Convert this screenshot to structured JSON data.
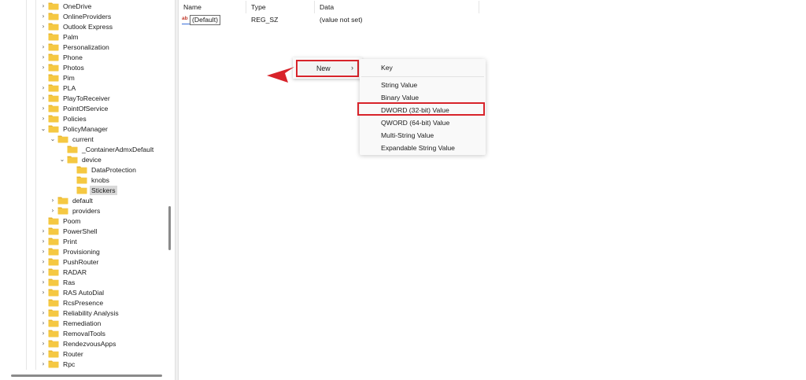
{
  "tree": {
    "items": [
      {
        "label": "OneDrive",
        "expander": "collapsed",
        "level": 0
      },
      {
        "label": "OnlineProviders",
        "expander": "collapsed",
        "level": 0
      },
      {
        "label": "Outlook Express",
        "expander": "collapsed",
        "level": 0
      },
      {
        "label": "Palm",
        "expander": "none",
        "level": 0
      },
      {
        "label": "Personalization",
        "expander": "collapsed",
        "level": 0
      },
      {
        "label": "Phone",
        "expander": "collapsed",
        "level": 0
      },
      {
        "label": "Photos",
        "expander": "collapsed",
        "level": 0
      },
      {
        "label": "Pim",
        "expander": "none",
        "level": 0
      },
      {
        "label": "PLA",
        "expander": "collapsed",
        "level": 0
      },
      {
        "label": "PlayToReceiver",
        "expander": "collapsed",
        "level": 0
      },
      {
        "label": "PointOfService",
        "expander": "collapsed",
        "level": 0
      },
      {
        "label": "Policies",
        "expander": "collapsed",
        "level": 0
      },
      {
        "label": "PolicyManager",
        "expander": "expanded",
        "level": 0
      },
      {
        "label": "current",
        "expander": "expanded",
        "level": 1
      },
      {
        "label": "_ContainerAdmxDefault",
        "expander": "none",
        "level": 2
      },
      {
        "label": "device",
        "expander": "expanded",
        "level": 2
      },
      {
        "label": "DataProtection",
        "expander": "none",
        "level": 3
      },
      {
        "label": "knobs",
        "expander": "none",
        "level": 3
      },
      {
        "label": "Stickers",
        "expander": "none",
        "level": 3,
        "selected": true
      },
      {
        "label": "default",
        "expander": "collapsed",
        "level": 1
      },
      {
        "label": "providers",
        "expander": "collapsed",
        "level": 1
      },
      {
        "label": "Poom",
        "expander": "none",
        "level": 0
      },
      {
        "label": "PowerShell",
        "expander": "collapsed",
        "level": 0
      },
      {
        "label": "Print",
        "expander": "collapsed",
        "level": 0
      },
      {
        "label": "Provisioning",
        "expander": "collapsed",
        "level": 0
      },
      {
        "label": "PushRouter",
        "expander": "collapsed",
        "level": 0
      },
      {
        "label": "RADAR",
        "expander": "collapsed",
        "level": 0
      },
      {
        "label": "Ras",
        "expander": "collapsed",
        "level": 0
      },
      {
        "label": "RAS AutoDial",
        "expander": "collapsed",
        "level": 0
      },
      {
        "label": "RcsPresence",
        "expander": "none",
        "level": 0
      },
      {
        "label": "Reliability Analysis",
        "expander": "collapsed",
        "level": 0
      },
      {
        "label": "Remediation",
        "expander": "collapsed",
        "level": 0
      },
      {
        "label": "RemovalTools",
        "expander": "collapsed",
        "level": 0
      },
      {
        "label": "RendezvousApps",
        "expander": "collapsed",
        "level": 0
      },
      {
        "label": "Router",
        "expander": "collapsed",
        "level": 0
      },
      {
        "label": "Rpc",
        "expander": "collapsed",
        "level": 0
      }
    ]
  },
  "columns": {
    "name": "Name",
    "type": "Type",
    "data": "Data"
  },
  "values": [
    {
      "icon": "string-value-icon",
      "name": "(Default)",
      "type": "REG_SZ",
      "data": "(value not set)"
    }
  ],
  "context_menu": {
    "new_label": "New",
    "new_chevron": "›",
    "submenu": {
      "key": "Key",
      "items": [
        "String Value",
        "Binary Value",
        "DWORD (32-bit) Value",
        "QWORD (64-bit) Value",
        "Multi-String Value",
        "Expandable String Value"
      ],
      "highlighted": "DWORD (32-bit) Value"
    }
  },
  "colors": {
    "highlight_border": "#d8232a",
    "folder_fill": "#f5c842",
    "folder_tab": "#e8b52e",
    "selection_bg": "#d9d9d9",
    "arrow": "#d8232a"
  },
  "icons": {
    "expander_collapsed": "›",
    "expander_expanded": "⌄",
    "string_value": "ab"
  }
}
